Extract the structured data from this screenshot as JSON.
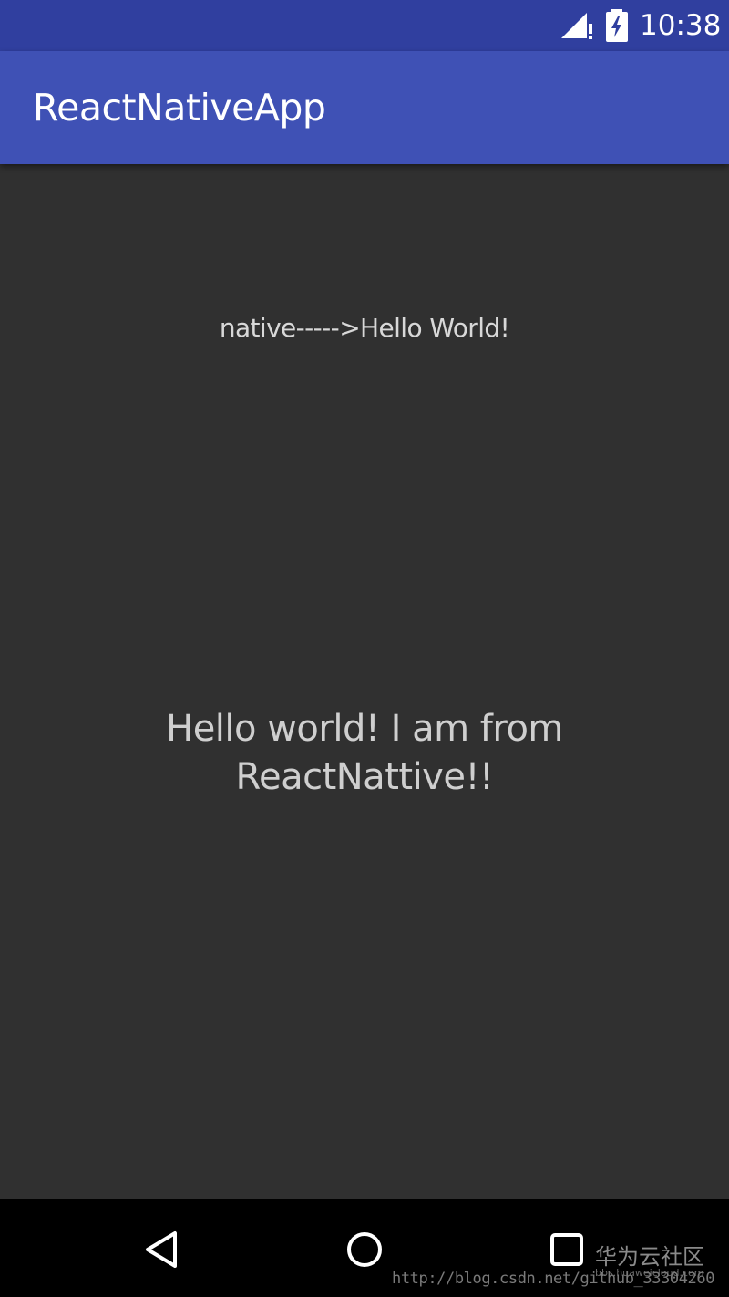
{
  "status_bar": {
    "time": "10:38",
    "signal_icon": "cell-signal-no-data-icon",
    "battery_icon": "battery-charging-icon",
    "color": "#303F9F"
  },
  "app_bar": {
    "title": "ReactNativeApp",
    "color": "#3F51B5"
  },
  "content": {
    "native_text": "native----->Hello World!",
    "react_native_text": "Hello world! I am from ReactNattive!!",
    "background": "#303030"
  },
  "nav_bar": {
    "back_icon": "back-triangle-icon",
    "home_icon": "home-circle-icon",
    "recents_icon": "recents-square-icon"
  },
  "watermark": {
    "brand": "华为云社区",
    "brand_url": "bbs.huaweicloud.com",
    "blog_url": "http://blog.csdn.net/github_33304260"
  }
}
